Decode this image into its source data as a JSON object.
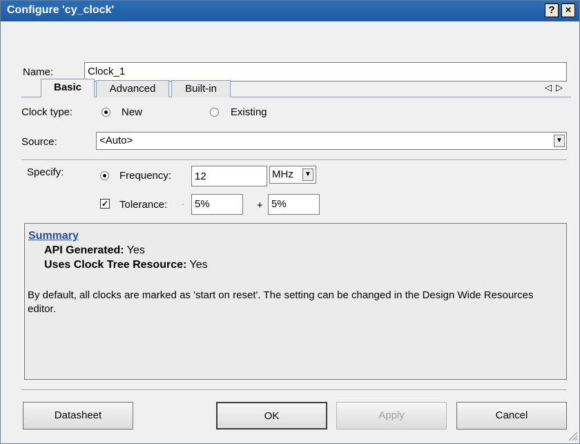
{
  "window": {
    "title": "Configure 'cy_clock'",
    "help_glyph": "?",
    "close_glyph": "×"
  },
  "name": {
    "label": "Name:",
    "value": "Clock_1"
  },
  "tabs": [
    {
      "label": "Basic",
      "active": true
    },
    {
      "label": "Advanced",
      "active": false
    },
    {
      "label": "Built-in",
      "active": false
    }
  ],
  "tab_scroll": {
    "left": "◁",
    "right": "▷"
  },
  "clock_type": {
    "label": "Clock type:",
    "options": [
      {
        "label": "New",
        "selected": true
      },
      {
        "label": "Existing",
        "selected": false
      }
    ]
  },
  "source": {
    "label": "Source:",
    "value": "<Auto>"
  },
  "specify": {
    "label": "Specify:",
    "frequency_label": "Frequency:",
    "frequency_value": "12",
    "unit": "MHz",
    "tolerance_label": "Tolerance:",
    "tolerance_checked": true,
    "minus_prefix": "·",
    "tolerance_minus": "5%",
    "plus_prefix": "+",
    "tolerance_plus": "5%"
  },
  "summary": {
    "heading": "Summary",
    "api_label": "API Generated:",
    "api_value": "Yes",
    "uses_label": "Uses Clock Tree Resource:",
    "uses_value": "Yes",
    "note": "By default, all clocks are marked as 'start on reset'. The setting can be changed in the Design Wide Resources editor."
  },
  "buttons": {
    "datasheet": "Datasheet",
    "ok": "OK",
    "apply": "Apply",
    "cancel": "Cancel"
  },
  "colors": {
    "title_bar": "#1f5aa6",
    "summary_link": "#1f4f9c"
  }
}
